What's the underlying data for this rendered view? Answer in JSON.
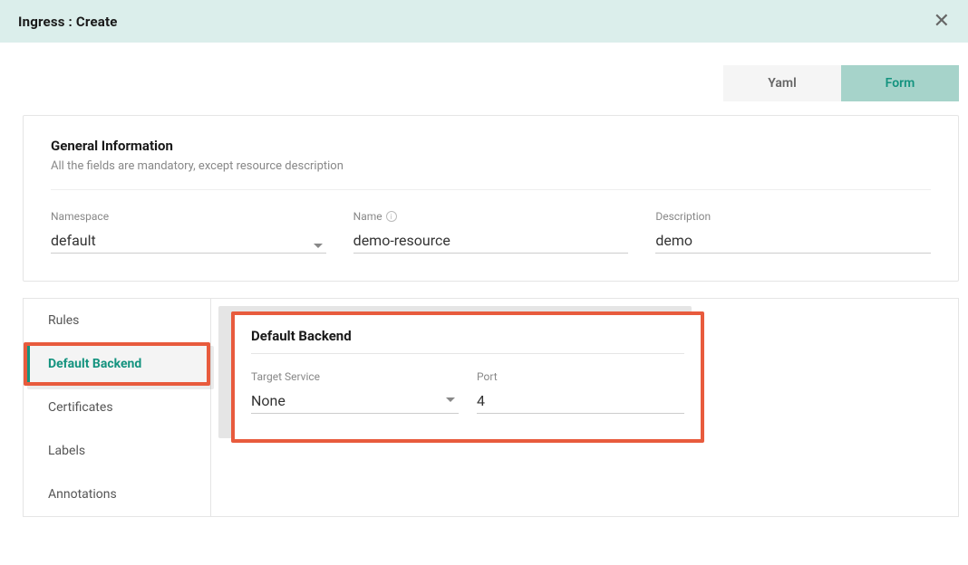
{
  "header": {
    "title": "Ingress : Create",
    "close_icon": "✕"
  },
  "tabs": {
    "yaml": "Yaml",
    "form": "Form"
  },
  "general": {
    "title": "General Information",
    "subtitle": "All the fields are mandatory, except resource description",
    "namespace_label": "Namespace",
    "namespace_value": "default",
    "name_label": "Name",
    "name_value": "demo-resource",
    "description_label": "Description",
    "description_value": "demo"
  },
  "sidebar": {
    "items": [
      {
        "label": "Rules"
      },
      {
        "label": "Default Backend"
      },
      {
        "label": "Certificates"
      },
      {
        "label": "Labels"
      },
      {
        "label": "Annotations"
      }
    ]
  },
  "backend": {
    "title": "Default Backend",
    "target_service_label": "Target Service",
    "target_service_value": "None",
    "port_label": "Port",
    "port_value": "4"
  }
}
